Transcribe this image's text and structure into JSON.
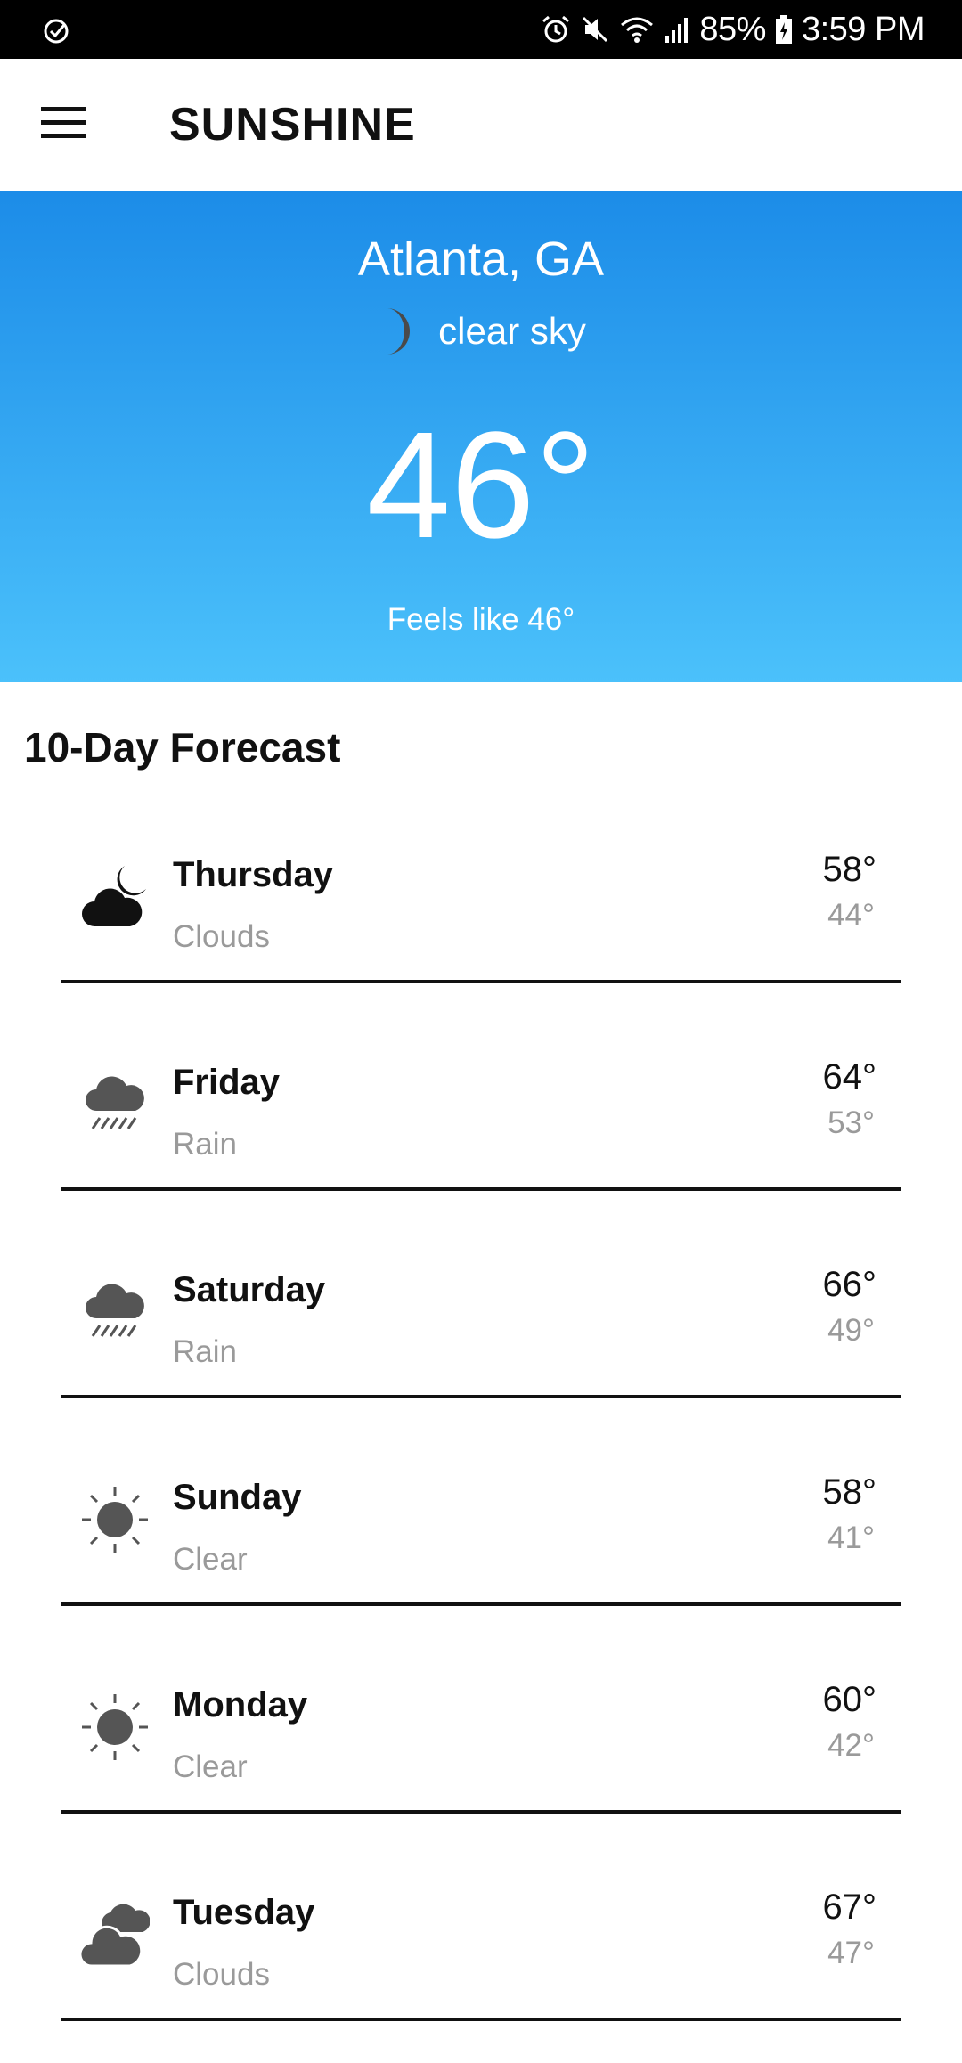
{
  "status_bar": {
    "battery": "85%",
    "time": "3:59 PM",
    "icons": [
      "check-circle-icon",
      "alarm-icon",
      "mute-icon",
      "wifi-icon",
      "signal-icon",
      "battery-charging-icon"
    ]
  },
  "app_bar": {
    "title": "SUNSHINE",
    "menu_icon": "hamburger-menu-icon"
  },
  "current": {
    "city": "Atlanta, GA",
    "condition": "clear sky",
    "condition_icon": "moon-icon",
    "temperature": "46°",
    "feels_like": "Feels like 46°"
  },
  "forecast": {
    "title": "10-Day Forecast",
    "days": [
      {
        "day": "Thursday",
        "desc": "Clouds",
        "high": "58°",
        "low": "44°",
        "icon": "cloud-moon-icon"
      },
      {
        "day": "Friday",
        "desc": "Rain",
        "high": "64°",
        "low": "53°",
        "icon": "rain-cloud-icon"
      },
      {
        "day": "Saturday",
        "desc": "Rain",
        "high": "66°",
        "low": "49°",
        "icon": "rain-cloud-icon"
      },
      {
        "day": "Sunday",
        "desc": "Clear",
        "high": "58°",
        "low": "41°",
        "icon": "sun-icon"
      },
      {
        "day": "Monday",
        "desc": "Clear",
        "high": "60°",
        "low": "42°",
        "icon": "sun-icon"
      },
      {
        "day": "Tuesday",
        "desc": "Clouds",
        "high": "67°",
        "low": "47°",
        "icon": "clouds-icon"
      }
    ]
  },
  "colors": {
    "hero_top": "#1c8ce8",
    "hero_bottom": "#4bc1fb",
    "secondary_text": "#9a9a9a",
    "icon_gray": "#555555"
  }
}
